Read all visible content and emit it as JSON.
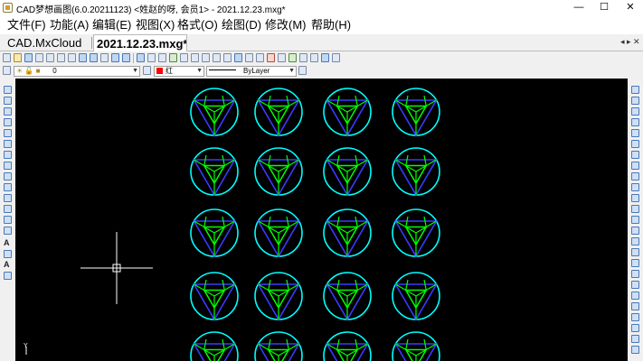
{
  "window": {
    "title": "CAD梦想画图(6.0.20211123) <姓赵的呀, 会员1> - 2021.12.23.mxg*",
    "minimize_glyph": "—",
    "maximize_glyph": "☐",
    "close_glyph": "✕"
  },
  "menu": [
    {
      "label": "文件(F)"
    },
    {
      "label": "功能(A)"
    },
    {
      "label": "编辑(E)"
    },
    {
      "label": "视图(X)"
    },
    {
      "label": "格式(O)"
    },
    {
      "label": "绘图(D)"
    },
    {
      "label": "修改(M)"
    },
    {
      "label": "帮助(H)"
    }
  ],
  "tabs": {
    "items": [
      {
        "label": "CAD.MxCloud"
      },
      {
        "label": "2021.12.23.mxg*"
      }
    ],
    "nav_glyphs": "◂ ▸ ✕"
  },
  "toolbar2": {
    "layer_value": "0",
    "color_value": "红",
    "color_swatch": "#ff0000",
    "linetype_value": "ByLayer"
  },
  "canvas": {
    "background": "#000000",
    "symbol_colors": {
      "circle": "#00ffff",
      "triangle": "#3a3aff",
      "inner": "#00ff00"
    },
    "crosshair_color": "#ffffff"
  },
  "ucs": {
    "y_label": "Y"
  }
}
